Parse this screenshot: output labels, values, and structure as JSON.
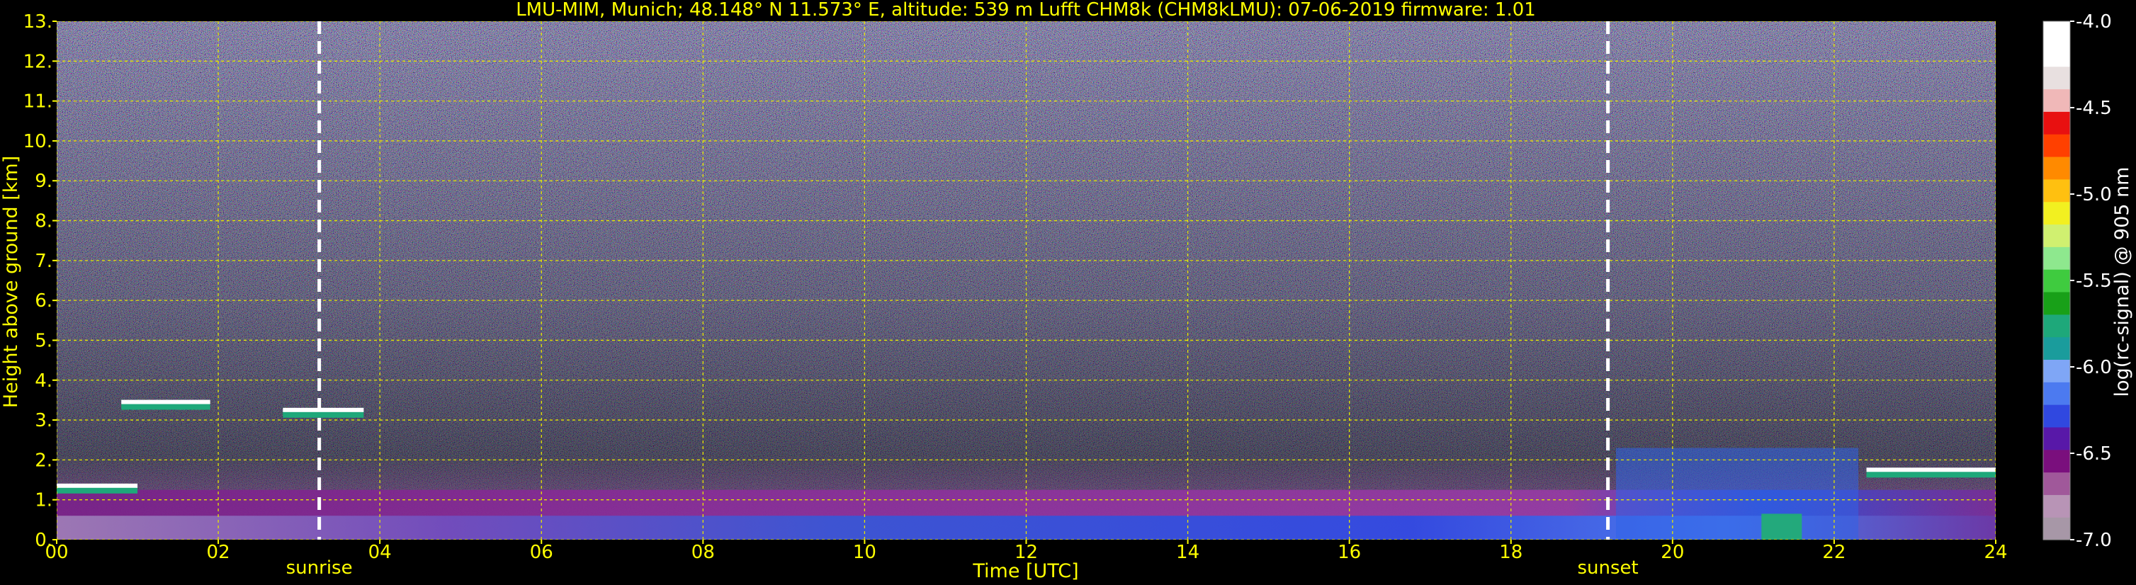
{
  "chart_data": {
    "type": "heatmap",
    "title": "LMU-MIM, Munich; 48.148° N 11.573° E, altitude: 539 m     Lufft CHM8k (CHM8kLMU): 07-06-2019     firmware: 1.01",
    "xlabel": "Time [UTC]",
    "ylabel": "Height above ground [km]",
    "xlim": [
      0,
      24
    ],
    "ylim": [
      0,
      13
    ],
    "x_tick_labels": [
      "00",
      "02",
      "04",
      "06",
      "08",
      "10",
      "12",
      "14",
      "16",
      "18",
      "20",
      "22",
      "24"
    ],
    "x_ticks": [
      0,
      2,
      4,
      6,
      8,
      10,
      12,
      14,
      16,
      18,
      20,
      22,
      24
    ],
    "y_tick_labels": [
      "0.",
      "1.",
      "2.",
      "3.",
      "4.",
      "5.",
      "6.",
      "7.",
      "8.",
      "9.",
      "10.",
      "11.",
      "12.",
      "13."
    ],
    "y_ticks": [
      0,
      1,
      2,
      3,
      4,
      5,
      6,
      7,
      8,
      9,
      10,
      11,
      12,
      13
    ],
    "grid": true,
    "annotations": [
      {
        "label": "sunrise",
        "x": 3.25
      },
      {
        "label": "sunset",
        "x": 19.2
      }
    ],
    "colorbar": {
      "label": "log(rc-signal) @ 905 nm",
      "range": [
        -7.0,
        -4.0
      ],
      "tick_labels": [
        "-4.0",
        "-4.5",
        "-5.0",
        "-5.5",
        "-6.0",
        "-6.5",
        "-7.0"
      ],
      "ticks": [
        -4.0,
        -4.5,
        -5.0,
        -5.5,
        -6.0,
        -6.5,
        -7.0
      ],
      "colors": [
        "#a797a7",
        "#b894b6",
        "#a0589a",
        "#7a0f7d",
        "#5818a8",
        "#3048e0",
        "#4c7af0",
        "#7fa6f6",
        "#1a9c9c",
        "#1ea87a",
        "#18a018",
        "#3fcb3f",
        "#8ee88e",
        "#d0f070",
        "#f2f020",
        "#ffc010",
        "#ff8a00",
        "#ff4000",
        "#e81010",
        "#f0b8b8",
        "#e8e0e0",
        "#ffffff",
        "#ffffff"
      ]
    },
    "features": [
      {
        "kind": "cloud",
        "x_start": 0.0,
        "x_end": 1.0,
        "height": 1.3
      },
      {
        "kind": "cloud",
        "x_start": 0.8,
        "x_end": 1.9,
        "height": 3.4
      },
      {
        "kind": "cloud",
        "x_start": 2.8,
        "x_end": 3.8,
        "height": 3.2
      },
      {
        "kind": "cloud",
        "x_start": 22.4,
        "x_end": 24.0,
        "height": 1.7
      }
    ]
  }
}
